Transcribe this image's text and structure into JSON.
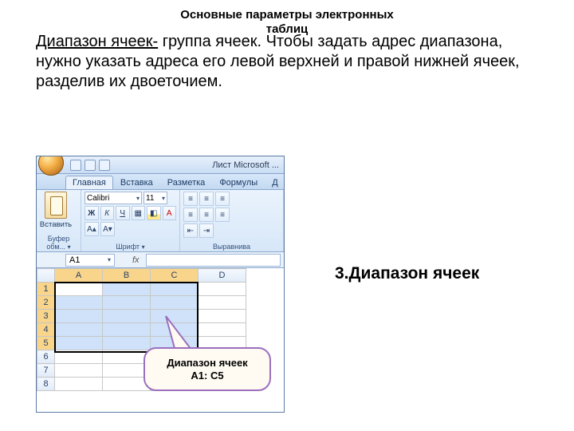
{
  "title_line1": "Основные параметры электронных",
  "title_line2": "таблиц",
  "paragraph_term": "Диапазон ячеек-",
  "paragraph_rest": " группа ячеек. Чтобы задать адрес диапазона, нужно указать адреса его левой верхней и правой нижней ячеек,  разделив их двоеточием.",
  "right_label": "3.Диапазон ячеек",
  "excel": {
    "window_title": "Лист Microsoft ...",
    "tabs": [
      "Главная",
      "Вставка",
      "Разметка",
      "Формулы",
      "Д"
    ],
    "paste_label": "Вставить",
    "group_clipboard": "Буфер обм...",
    "group_font": "Шрифт",
    "group_align": "Выравнива",
    "font_name": "Calibri",
    "font_size": "11",
    "namebox": "A1",
    "fx": "fx",
    "cols": [
      "A",
      "B",
      "C",
      "D"
    ],
    "rows": [
      "1",
      "2",
      "3",
      "4",
      "5",
      "6",
      "7",
      "8"
    ]
  },
  "callout_line1": "Диапазон ячеек",
  "callout_line2": "А1: С5"
}
